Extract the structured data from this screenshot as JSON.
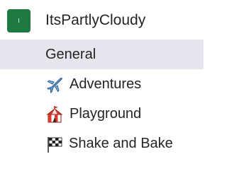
{
  "team": {
    "name": "ItsPartlyCloudy",
    "avatar_text": "I",
    "avatar_color": "#1f7a41"
  },
  "channels": [
    {
      "label": "General",
      "icon": "",
      "selected": true
    },
    {
      "label": "Adventures",
      "icon": "airplane-icon",
      "selected": false
    },
    {
      "label": "Playground",
      "icon": "circus-tent-icon",
      "selected": false
    },
    {
      "label": "Shake and Bake",
      "icon": "checkered-flag-icon",
      "selected": false
    }
  ],
  "colors": {
    "selected_background": "#e6e6ef",
    "text": "#252423"
  }
}
